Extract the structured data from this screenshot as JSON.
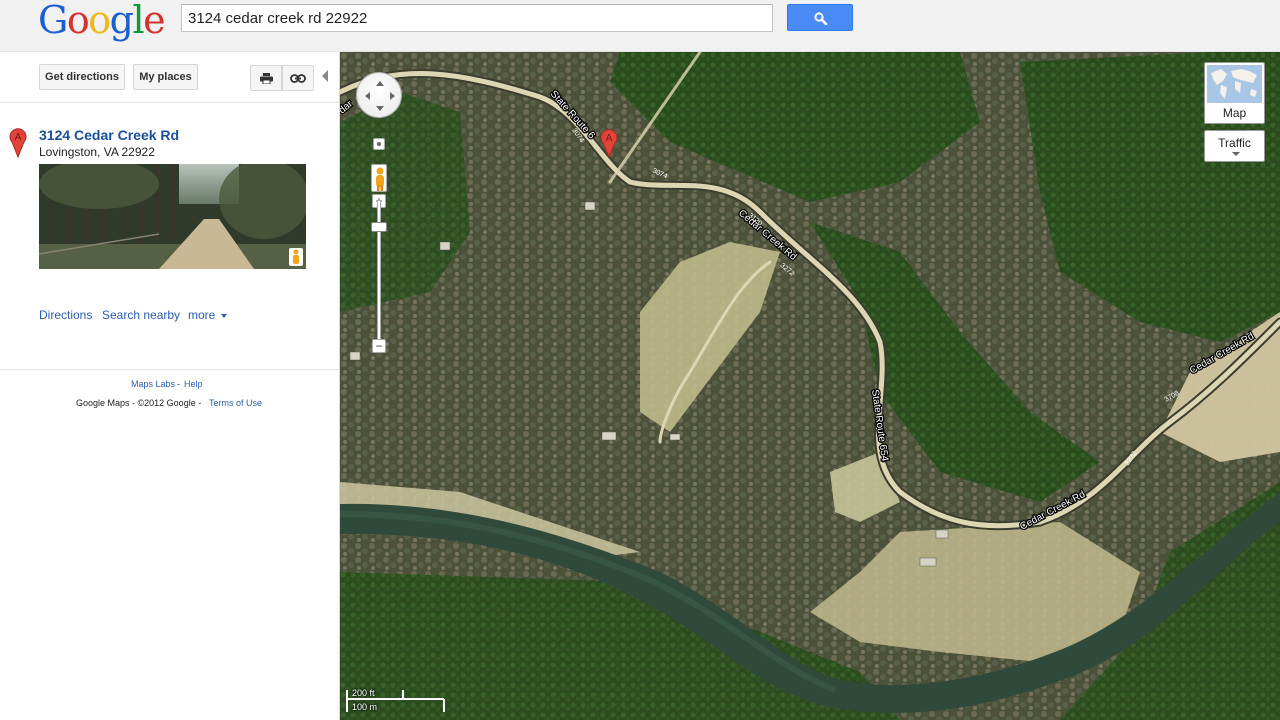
{
  "header": {
    "logo_text": "Google",
    "search_value": "3124 cedar creek rd 22922",
    "search_icon": "search-icon"
  },
  "sidebar": {
    "get_directions": "Get directions",
    "my_places": "My places",
    "print_icon": "print-icon",
    "link_icon": "link-icon",
    "marker_letter": "A",
    "result_title": "3124 Cedar Creek Rd",
    "result_address": "Lovingston, VA 22922",
    "links": {
      "directions": "Directions",
      "search_nearby": "Search nearby",
      "more": "more"
    },
    "footer": {
      "maps_labs": "Maps Labs",
      "separator": "-",
      "help": "Help",
      "copyright": "Google Maps - ©2012 Google -",
      "terms": "Terms of Use"
    }
  },
  "map": {
    "type_label": "Map",
    "traffic_label": "Traffic",
    "marker_letter": "A",
    "scale_ft": "200 ft",
    "scale_m": "100 m",
    "road_labels": {
      "state_route_top": "State Route 6",
      "cedar_creek_1": "Cedar Creek Rd",
      "state_route_654": "State Route 654",
      "cedar_creek_2": "Cedar Creek Rd",
      "cedar_creek_3": "Cedar Creek Rd",
      "dar_fragment": "dar"
    },
    "shields": {
      "s3074a": "3074",
      "s3074b": "3074",
      "s3120": "3120",
      "s3272a": "3272",
      "s3272b": "3272",
      "s3708": "3708"
    }
  }
}
